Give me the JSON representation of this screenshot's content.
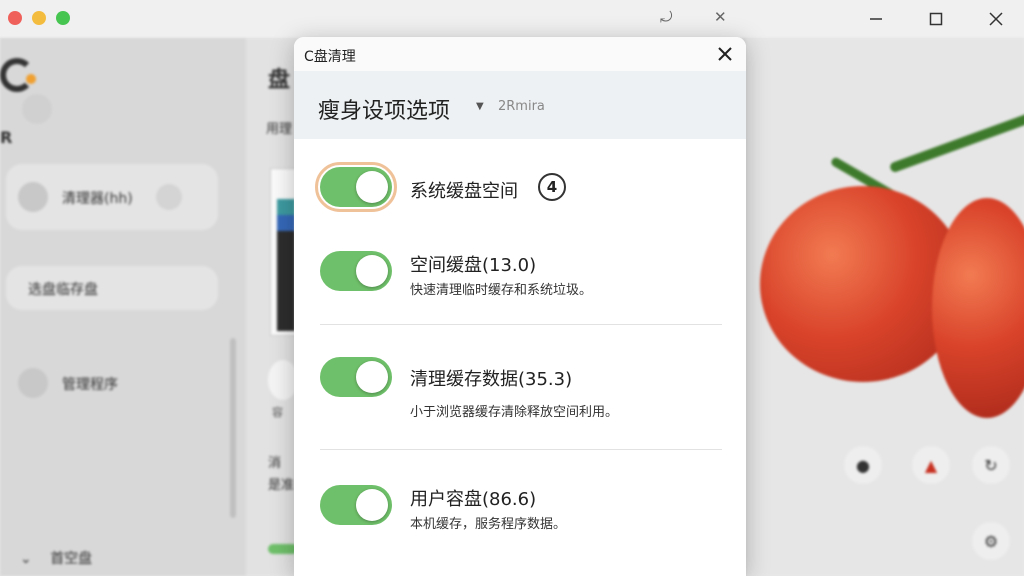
{
  "titlebar": {
    "icons": [
      "swap-icon",
      "pen-icon"
    ],
    "window_controls": [
      "minimize-icon",
      "maximize-icon",
      "close-icon"
    ]
  },
  "background": {
    "header_char": "盘",
    "sub_char": "用理",
    "sidebar_items": [
      {
        "label": "清理器(hh)",
        "icon": "disk-icon"
      },
      {
        "label": "选盘临存盘",
        "icon": ""
      },
      {
        "label": "管理程序",
        "icon": "tools-icon"
      }
    ],
    "sidebar_footer": "首空盘",
    "side_text_1": "容",
    "side_text_2": "消",
    "side_text_3": "是准"
  },
  "modal": {
    "title": "C盘清理",
    "section_title": "瘦身设项选项",
    "section_sub": "2Rmira",
    "options": [
      {
        "label": "系统缓盘空间",
        "badge": "4",
        "desc": "",
        "enabled": true
      },
      {
        "label": "空间缓盘(13.0)",
        "desc": "快速清理临时缓存和系统垃圾。",
        "enabled": true
      },
      {
        "label": "清理缓存数据(35.3)",
        "desc": "小于浏览器缓存清除释放空间利用。",
        "enabled": true
      },
      {
        "label": "用户容盘(86.6)",
        "desc": "本机缓存，服务程序数据。",
        "enabled": true
      }
    ]
  },
  "colors": {
    "toggle_on": "#6fc06a",
    "focus_ring": "#f0c29a",
    "accent": "#f0a030"
  }
}
